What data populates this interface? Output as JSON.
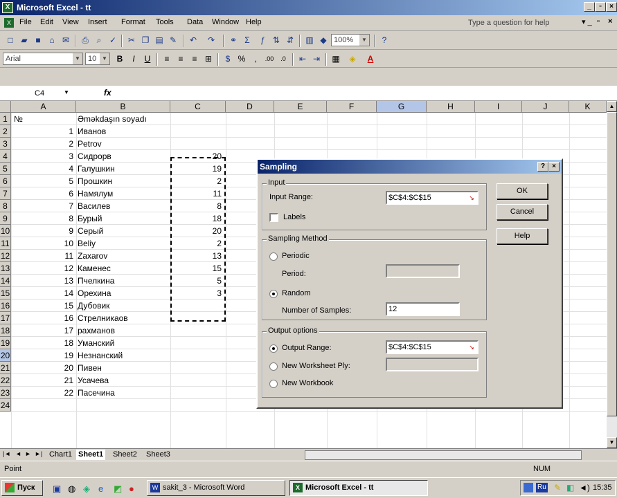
{
  "window": {
    "title": "Microsoft Excel - tt"
  },
  "menu": [
    "File",
    "Edit",
    "View",
    "Insert",
    "Format",
    "Tools",
    "Data",
    "Window",
    "Help"
  ],
  "help_box": "Type a question for help",
  "toolbar": {
    "zoom": "100%"
  },
  "format_toolbar": {
    "font": "Arial",
    "size": "10"
  },
  "formula_bar": {
    "name_box": "C4",
    "fx": "fx"
  },
  "columns": [
    "A",
    "B",
    "C",
    "D",
    "E",
    "F",
    "G",
    "H",
    "I",
    "J",
    "K"
  ],
  "rows": [
    "1",
    "2",
    "3",
    "4",
    "5",
    "6",
    "7",
    "8",
    "9",
    "10",
    "11",
    "12",
    "13",
    "14",
    "15",
    "16",
    "17",
    "18",
    "19",
    "20",
    "21",
    "22",
    "23",
    "24"
  ],
  "sheet": {
    "header": {
      "a": "№",
      "b": "Əməkdaşın soyadı"
    },
    "data": [
      {
        "n": "1",
        "name": "Иванов",
        "c": ""
      },
      {
        "n": "2",
        "name": "Petrov",
        "c": ""
      },
      {
        "n": "3",
        "name": "Сидрорв",
        "c": "20"
      },
      {
        "n": "4",
        "name": "Галушкин",
        "c": "19"
      },
      {
        "n": "5",
        "name": "Прошкин",
        "c": "2"
      },
      {
        "n": "6",
        "name": "Намялум",
        "c": "11"
      },
      {
        "n": "7",
        "name": "Василев",
        "c": "8"
      },
      {
        "n": "8",
        "name": "Бурый",
        "c": "18"
      },
      {
        "n": "9",
        "name": "Серый",
        "c": "20"
      },
      {
        "n": "10",
        "name": "Beliy",
        "c": "2"
      },
      {
        "n": "11",
        "name": "Zaxarov",
        "c": "13"
      },
      {
        "n": "12",
        "name": "Каменес",
        "c": "15"
      },
      {
        "n": "13",
        "name": "Пчелкина",
        "c": "5"
      },
      {
        "n": "14",
        "name": "Орехина",
        "c": "3"
      },
      {
        "n": "15",
        "name": "Дубовик",
        "c": ""
      },
      {
        "n": "16",
        "name": "Стрелникаов",
        "c": ""
      },
      {
        "n": "17",
        "name": "рахманов",
        "c": ""
      },
      {
        "n": "18",
        "name": "Уманский",
        "c": ""
      },
      {
        "n": "19",
        "name": "Незнанский",
        "c": ""
      },
      {
        "n": "20",
        "name": "Пивен",
        "c": ""
      },
      {
        "n": "21",
        "name": "Усачева",
        "c": ""
      },
      {
        "n": "22",
        "name": "Пасечина",
        "c": ""
      }
    ]
  },
  "sheet_tabs": [
    "Chart1",
    "Sheet1",
    "Sheet2",
    "Sheet3"
  ],
  "status": {
    "left": "Point",
    "num": "NUM"
  },
  "taskbar": {
    "start": "Пуск",
    "word": "sakit_3 - Microsoft Word",
    "excel": "Microsoft Excel - tt",
    "lang": "Ru",
    "clock": "15:35"
  },
  "dialog": {
    "title": "Sampling",
    "input_group": "Input",
    "input_range_label": "Input Range:",
    "input_range": "$C$4:$C$15",
    "labels": "Labels",
    "method_group": "Sampling Method",
    "periodic": "Periodic",
    "period_label": "Period:",
    "period": "",
    "random": "Random",
    "samples_label": "Number of Samples:",
    "samples": "12",
    "output_group": "Output options",
    "output_range_label": "Output Range:",
    "output_range": "$C$4:$C$15",
    "new_ply": "New Worksheet Ply:",
    "new_ply_value": "",
    "new_workbook": "New Workbook",
    "ok": "OK",
    "cancel": "Cancel",
    "help": "Help"
  }
}
